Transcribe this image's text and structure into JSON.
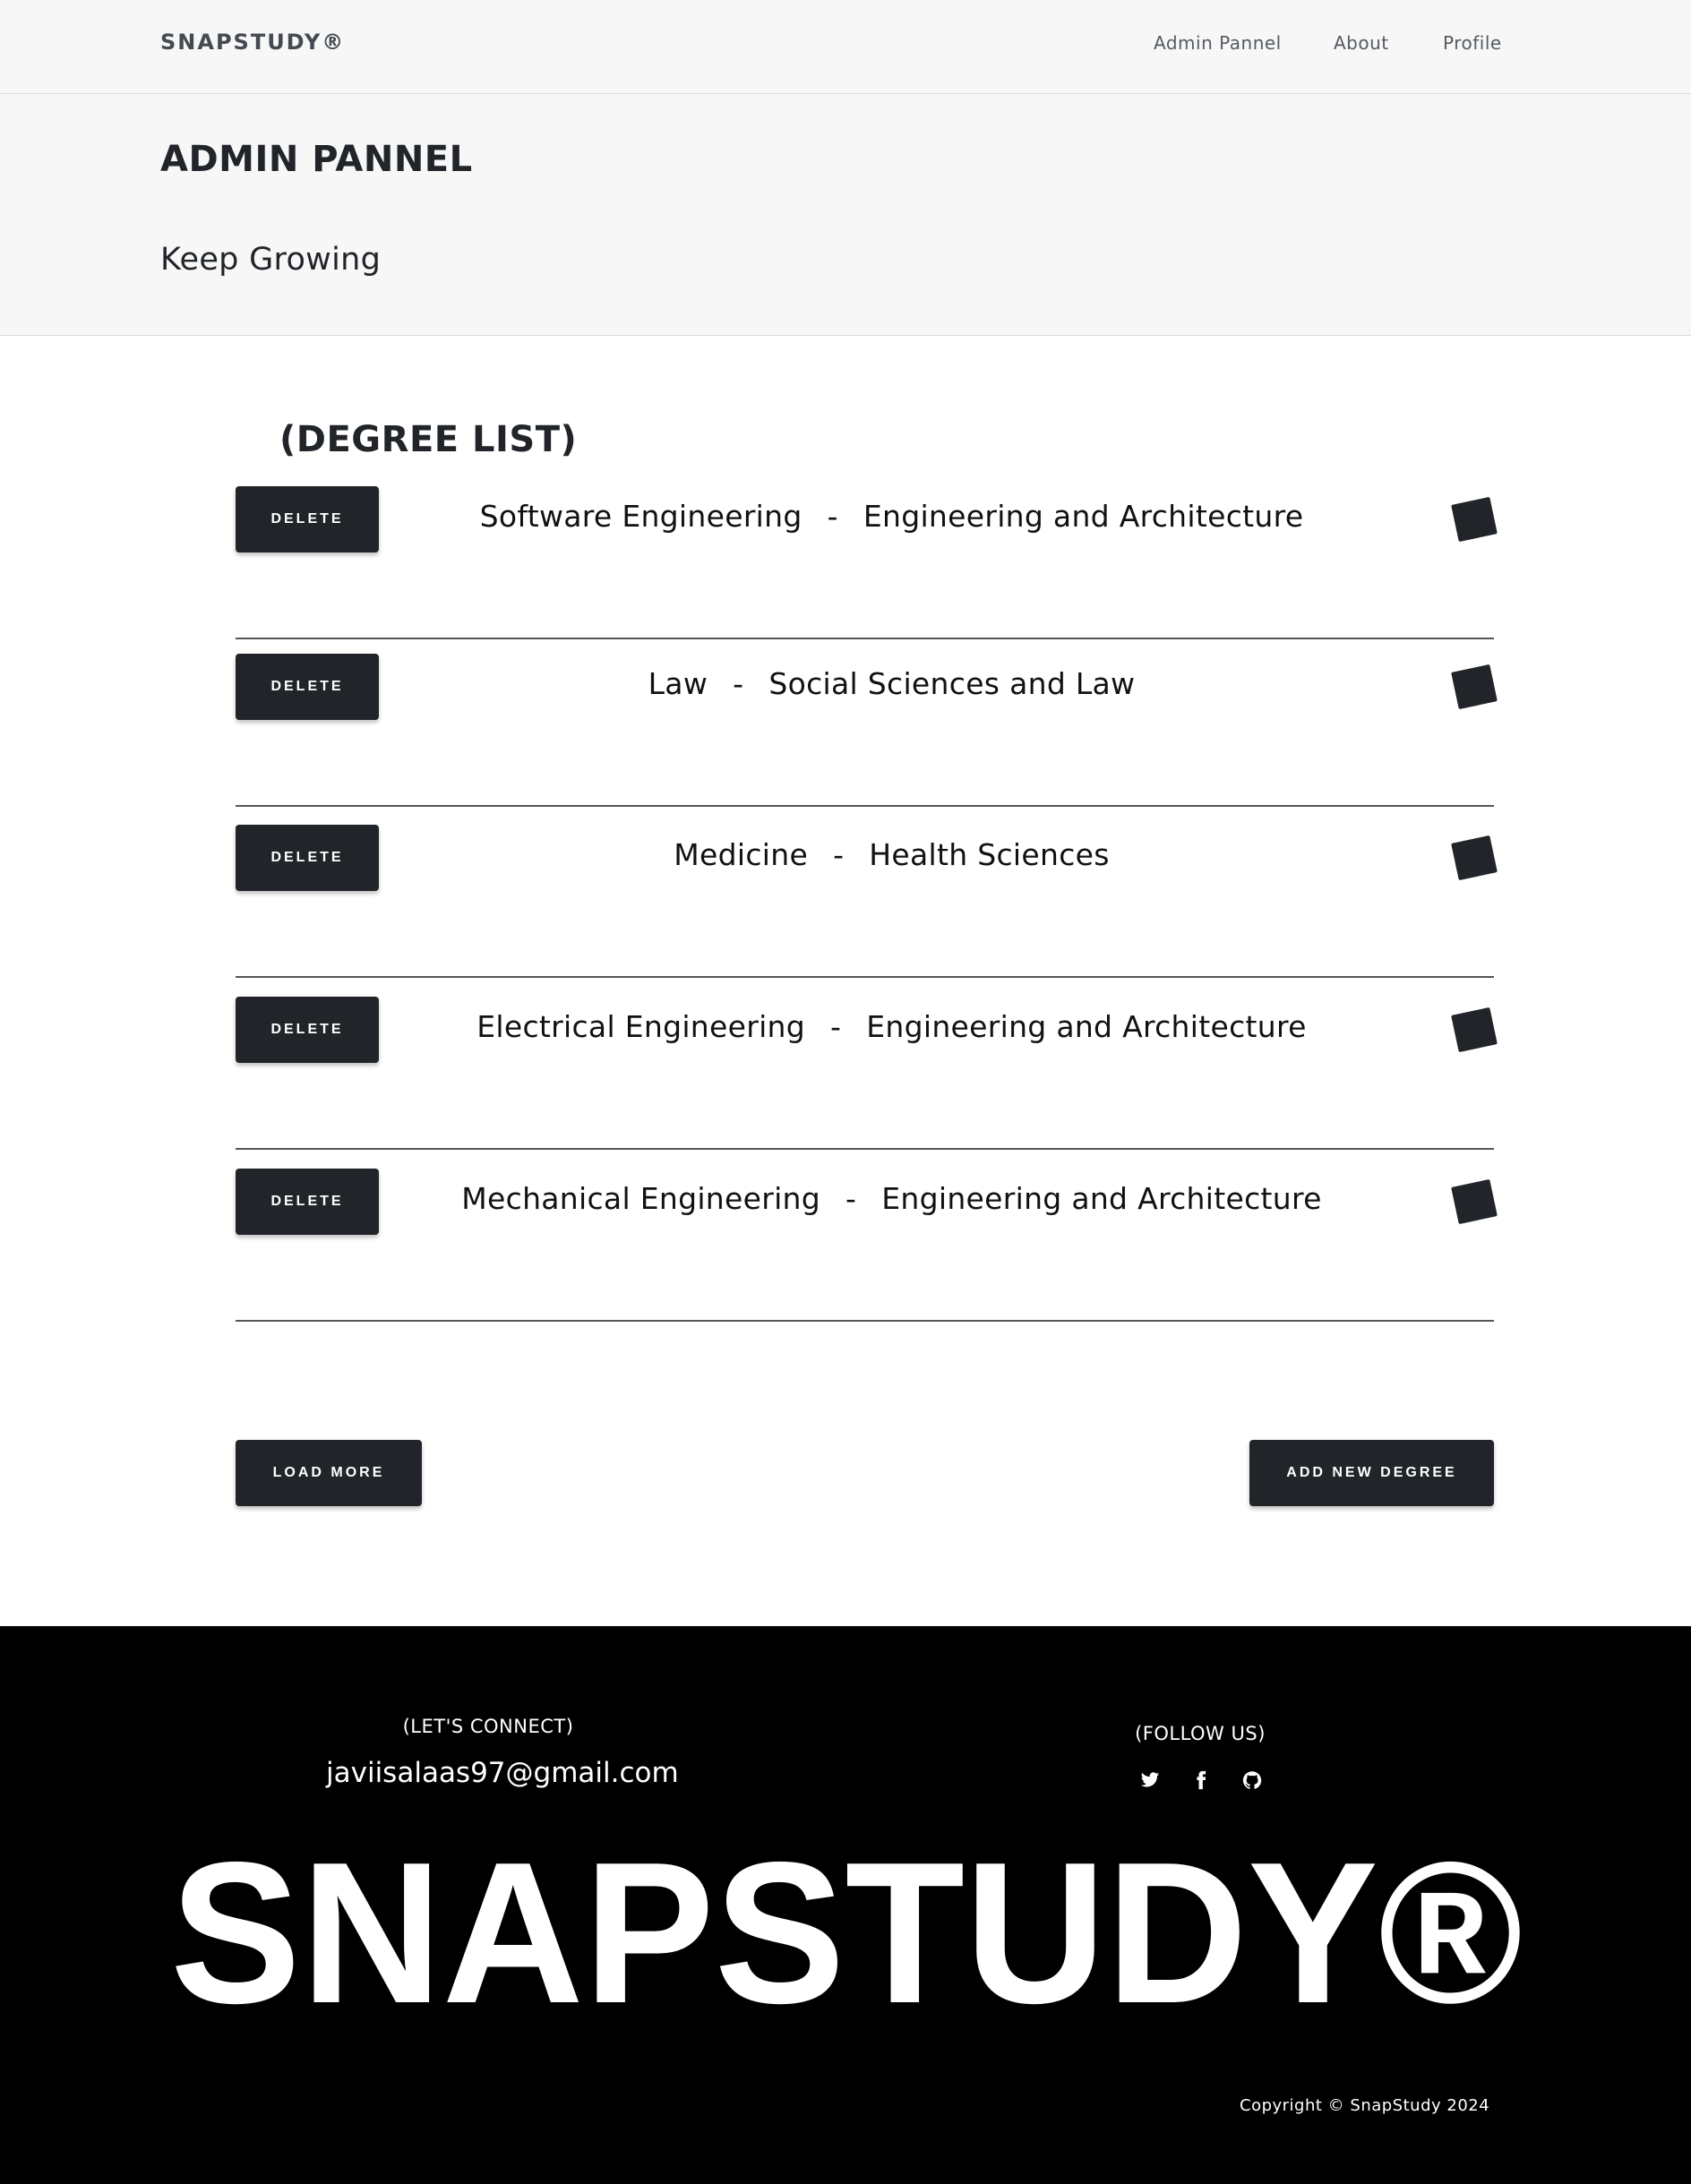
{
  "nav": {
    "brand": "SNAPSTUDY®",
    "links": [
      "Admin Pannel",
      "About",
      "Profile"
    ]
  },
  "header": {
    "title": "ADMIN PANNEL",
    "subtitle": "Keep Growing"
  },
  "main": {
    "section_title": "(DEGREE LIST)",
    "delete_label": "DELETE",
    "separator": "-",
    "degrees": [
      {
        "name": "Software Engineering",
        "faculty": "Engineering and Architecture"
      },
      {
        "name": "Law",
        "faculty": "Social Sciences and Law"
      },
      {
        "name": "Medicine",
        "faculty": "Health Sciences"
      },
      {
        "name": "Electrical Engineering",
        "faculty": "Engineering and Architecture"
      },
      {
        "name": "Mechanical Engineering",
        "faculty": "Engineering and Architecture"
      }
    ],
    "load_more_label": "LOAD MORE",
    "add_new_label": "ADD NEW DEGREE"
  },
  "footer": {
    "connect_label": "(LET'S CONNECT)",
    "email": "javiisalaas97@gmail.com",
    "follow_label": "(FOLLOW US)",
    "social_icons": [
      "twitter-icon",
      "facebook-icon",
      "github-icon"
    ],
    "big_brand": "SNAPSTUDY®",
    "copyright": "Copyright © SnapStudy 2024"
  },
  "colors": {
    "dark": "#212529",
    "light_bg": "#f7f7f7",
    "footer_bg": "#000000",
    "white": "#ffffff"
  }
}
